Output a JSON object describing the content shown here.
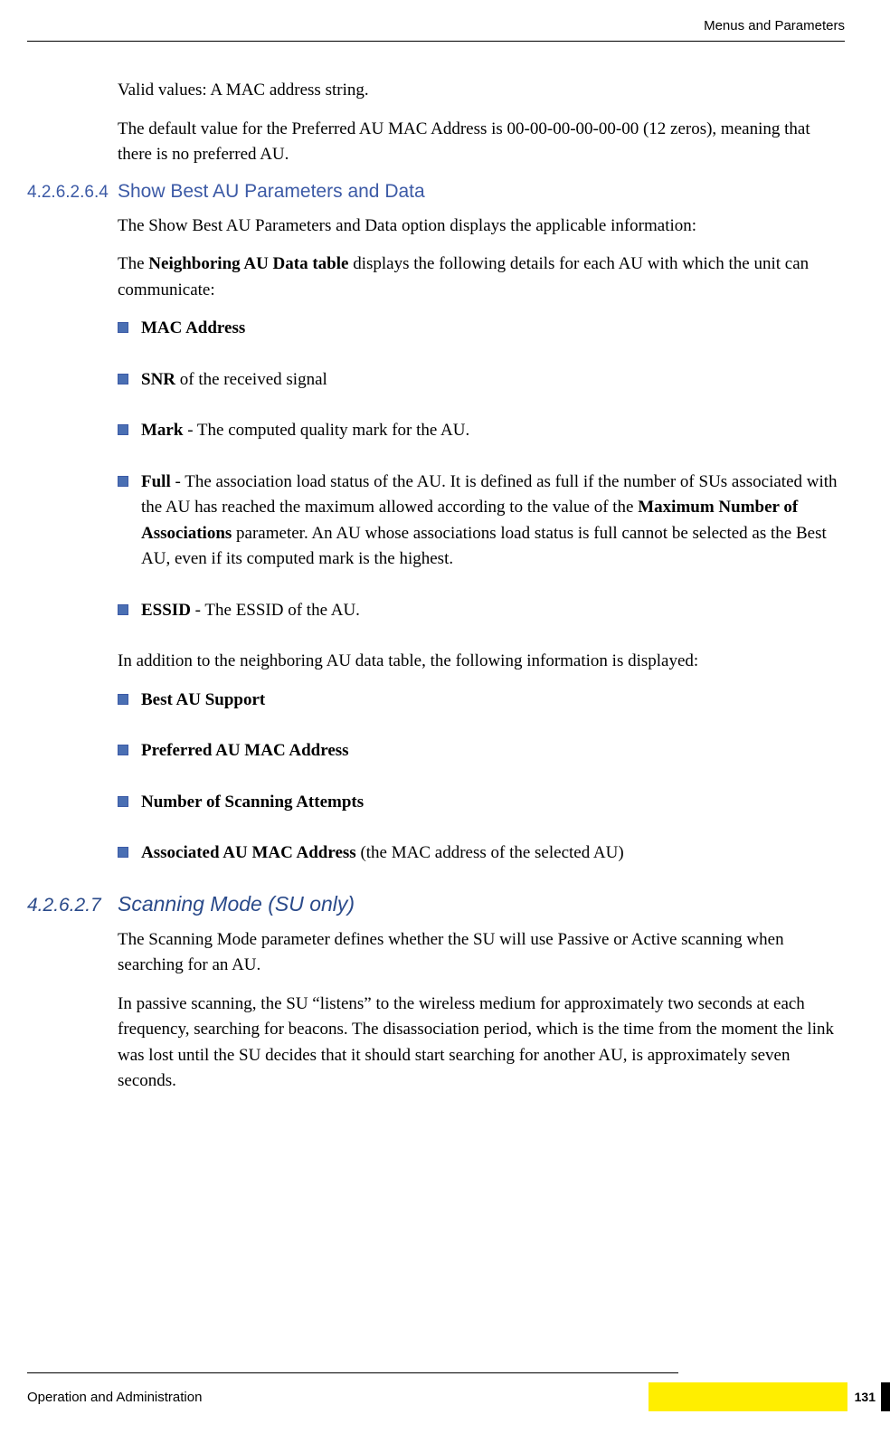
{
  "header": {
    "title": "Menus and Parameters"
  },
  "intro": {
    "p1": "Valid values: A MAC address string.",
    "p2": "The default value for the Preferred AU MAC Address is 00-00-00-00-00-00 (12 zeros), meaning that there is no preferred AU."
  },
  "section1": {
    "number": "4.2.6.2.6.4",
    "title": "Show Best AU Parameters and Data",
    "p1": "The Show Best AU Parameters and Data option displays the applicable information:",
    "p2_pre": "The ",
    "p2_bold": "Neighboring AU Data table",
    "p2_post": " displays the following details for each AU with which the unit can communicate:",
    "bullets1": [
      {
        "bold": "MAC Address",
        "rest": ""
      },
      {
        "bold": "SNR",
        "rest": " of the received signal"
      },
      {
        "bold": "Mark",
        "rest": " - The computed quality mark for the AU."
      },
      {
        "bold": "Full",
        "rest_pre": " - The association load status of the AU. It is defined as full if the number of SUs associated with the AU has reached the maximum allowed according to the value of the ",
        "rest_bold": "Maximum Number of Associations",
        "rest_post": " parameter. An AU whose associations load status is full cannot be selected as the Best AU, even if its computed mark is the highest."
      },
      {
        "bold": "ESSID",
        "rest": " - The ESSID of the AU."
      }
    ],
    "p3": "In addition to the neighboring AU data table, the following information is displayed:",
    "bullets2": [
      {
        "bold": "Best AU Support",
        "rest": ""
      },
      {
        "bold": "Preferred AU MAC Address",
        "rest": ""
      },
      {
        "bold": "Number of Scanning Attempts",
        "rest": ""
      },
      {
        "bold": "Associated AU MAC Address",
        "rest": " (the MAC address of the selected AU)"
      }
    ]
  },
  "section2": {
    "number": "4.2.6.2.7",
    "title": "Scanning Mode (SU only)",
    "p1": "The Scanning Mode parameter defines whether the SU will use Passive or Active scanning when searching for an AU.",
    "p2": "In passive scanning, the SU “listens” to the wireless medium for approximately two seconds at each frequency, searching for beacons. The disassociation period, which is the time from the moment the link was lost until the SU decides that it should start searching for another AU, is approximately seven seconds."
  },
  "footer": {
    "left": "Operation and Administration",
    "page_num": "131"
  }
}
